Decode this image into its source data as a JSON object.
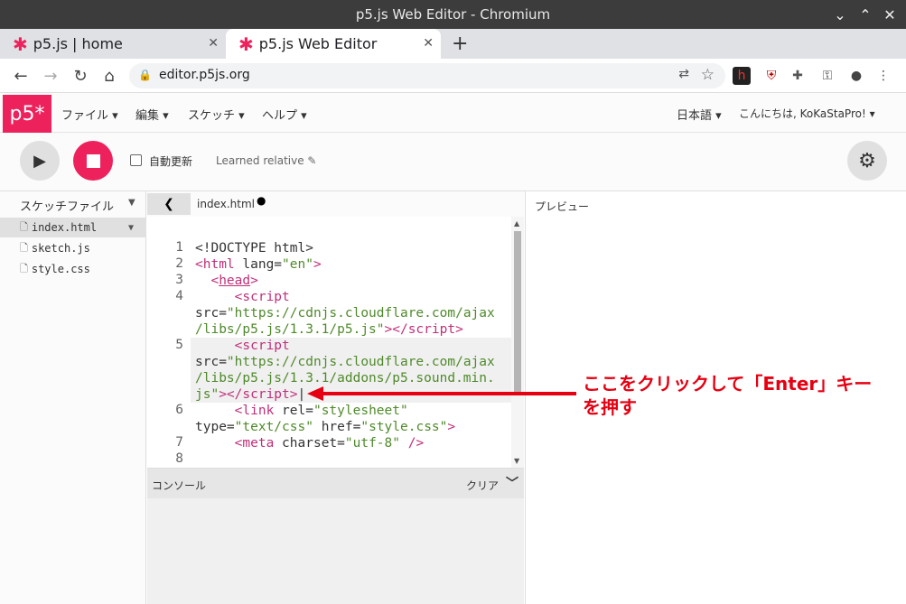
{
  "window": {
    "title": "p5.js Web Editor - Chromium"
  },
  "tabs": [
    {
      "label": "p5.js | home"
    },
    {
      "label": "p5.js Web Editor"
    }
  ],
  "browser": {
    "url": "editor.p5js.org"
  },
  "nav": {
    "logo": "p5*",
    "menus": [
      "ファイル ▾",
      "編集 ▾",
      "スケッチ ▾",
      "ヘルプ ▾"
    ],
    "language": "日本語 ▾",
    "user": "こんにちは, KoKaStaPro! ▾"
  },
  "toolbar": {
    "auto_refresh_label": "自動更新",
    "project_name": "Learned relative ✎"
  },
  "sidebar": {
    "title": "スケッチファイル",
    "files": [
      "index.html",
      "sketch.js",
      "style.css"
    ]
  },
  "editor": {
    "filename": "index.html",
    "modified_marker": "●",
    "line_numbers": [
      "1",
      "2",
      "3",
      "4",
      "5",
      "6",
      "7",
      "8"
    ]
  },
  "console": {
    "label": "コンソール",
    "clear": "クリア"
  },
  "preview": {
    "label": "プレビュー"
  },
  "annotation": {
    "line1": "ここをクリックして「Enter」キー",
    "line2": "を押す",
    "color": "#e60012"
  },
  "colors": {
    "accent": "#ed225d",
    "tag": "#c0307a",
    "string": "#4f8a2a"
  }
}
